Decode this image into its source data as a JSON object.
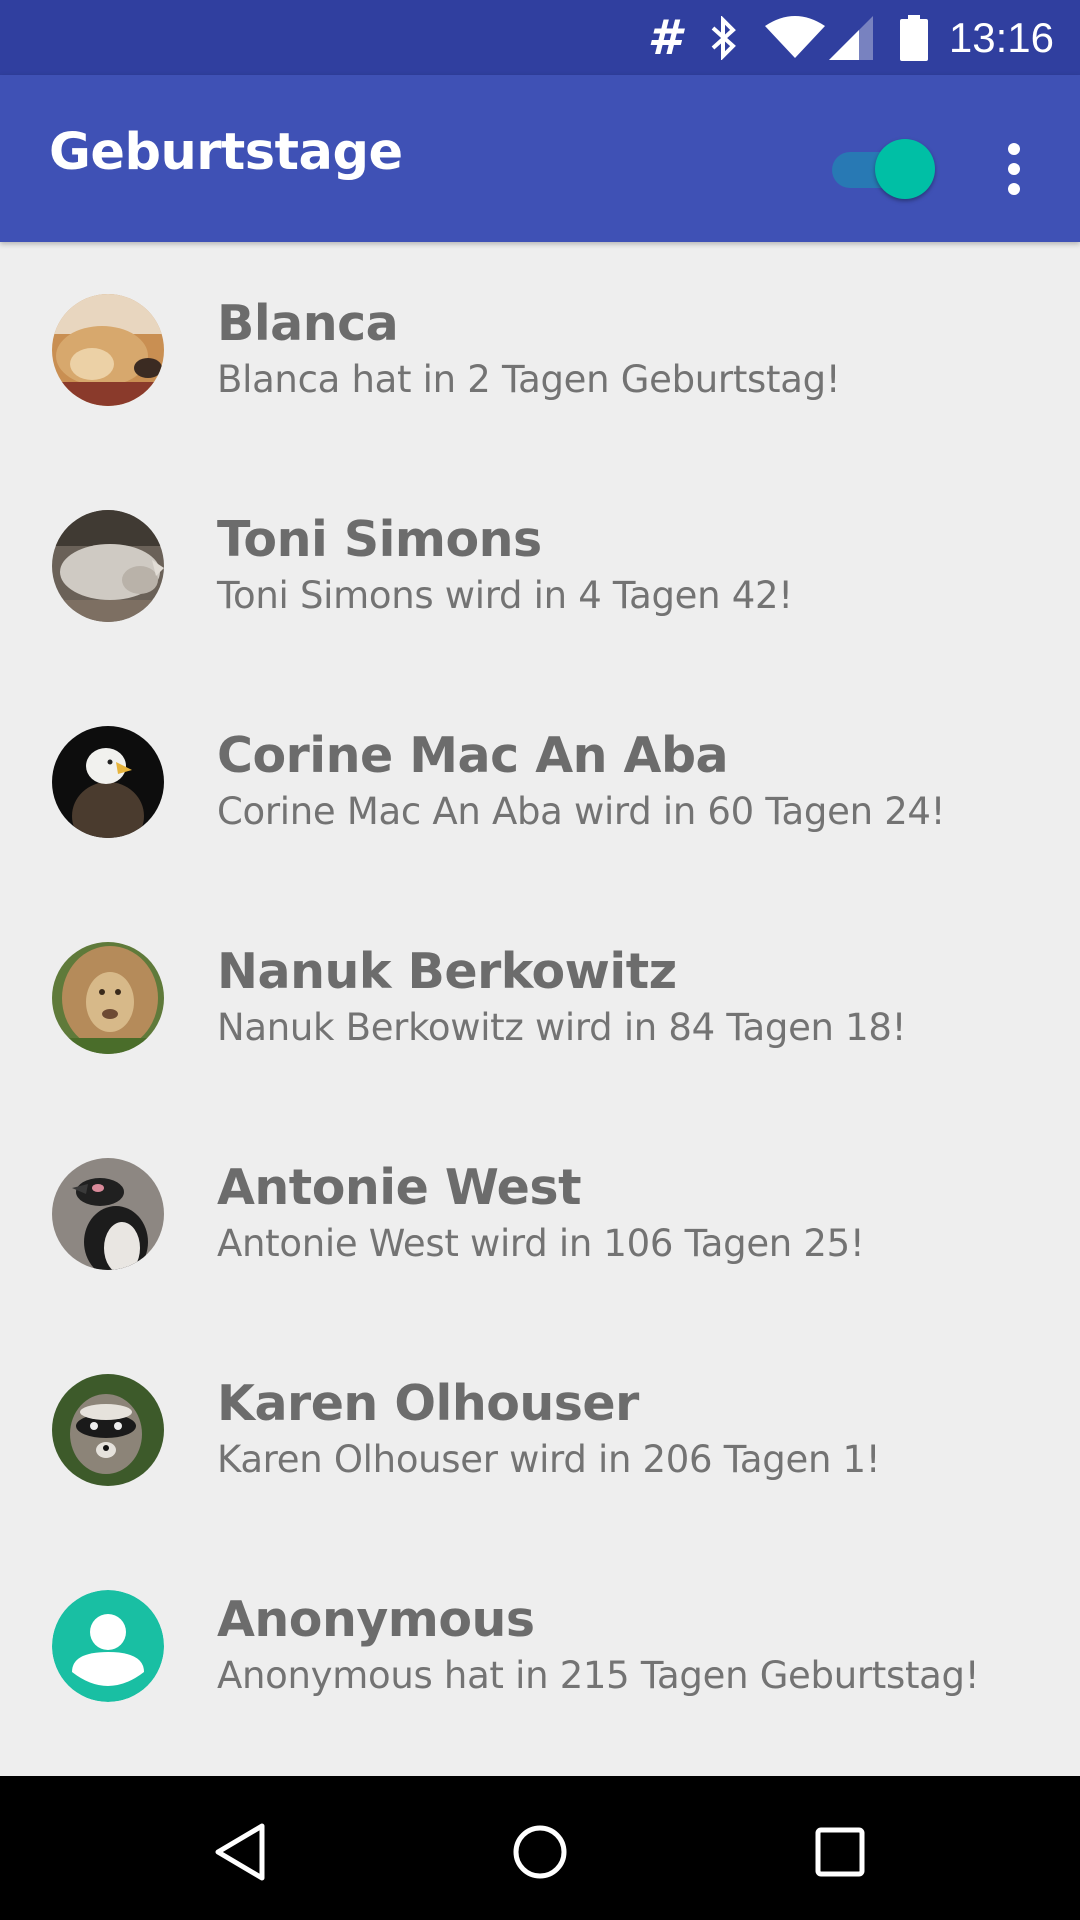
{
  "status_bar": {
    "hash_glyph": "#",
    "time": "13:16",
    "icons": [
      "hash-icon",
      "bluetooth-icon",
      "wifi-icon",
      "cell-signal-icon",
      "battery-icon"
    ]
  },
  "app_bar": {
    "title": "Geburtstage",
    "toggle_on": true,
    "colors": {
      "primary": "#3f51b5",
      "primary_dark": "#303f9f",
      "accent": "#00bfa5"
    }
  },
  "contacts": [
    {
      "name": "Blanca",
      "message": "Blanca hat in 2 Tagen Geburtstag!",
      "avatar": "dog-photo"
    },
    {
      "name": "Toni Simons",
      "message": "Toni Simons wird in 4 Tagen 42!",
      "avatar": "rhino-photo"
    },
    {
      "name": "Corine Mac An Aba",
      "message": "Corine Mac An Aba wird in 60 Tagen 24!",
      "avatar": "eagle-photo"
    },
    {
      "name": "Nanuk Berkowitz",
      "message": "Nanuk Berkowitz wird in 84 Tagen 18!",
      "avatar": "lion-photo"
    },
    {
      "name": "Antonie West",
      "message": "Antonie West wird in 106 Tagen 25!",
      "avatar": "penguin-photo"
    },
    {
      "name": "Karen Olhouser",
      "message": "Karen Olhouser wird in 206 Tagen 1!",
      "avatar": "raccoon-photo"
    },
    {
      "name": "Anonymous",
      "message": "Anonymous hat in 215 Tagen Geburtstag!",
      "avatar": "default-person-icon"
    }
  ],
  "nav_bar": {
    "icons": [
      "back-icon",
      "home-icon",
      "recents-icon"
    ]
  }
}
